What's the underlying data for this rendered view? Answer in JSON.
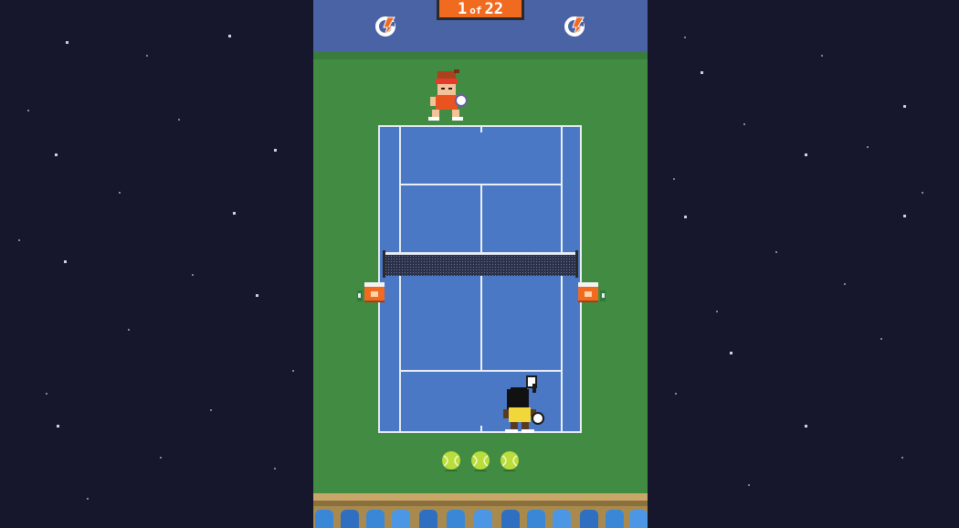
{
  "game": {
    "counter": {
      "current": "1",
      "word": "of",
      "total": "22"
    }
  },
  "colors": {
    "space": "#16162c",
    "grass": "#418c42",
    "topbar": "#4a63a4",
    "court": "#4a78c4",
    "court_lines": "#e9eef7",
    "accent_orange": "#f06a1f",
    "ball_green": "#b9dd3a",
    "fans_blue": "#3a87d8"
  },
  "icons": {
    "sponsor_logo": "g-bolt-icon",
    "balls_remaining": "tennis-ball-icon",
    "cooler": "drink-cooler-icon"
  },
  "balls_remaining": 3
}
